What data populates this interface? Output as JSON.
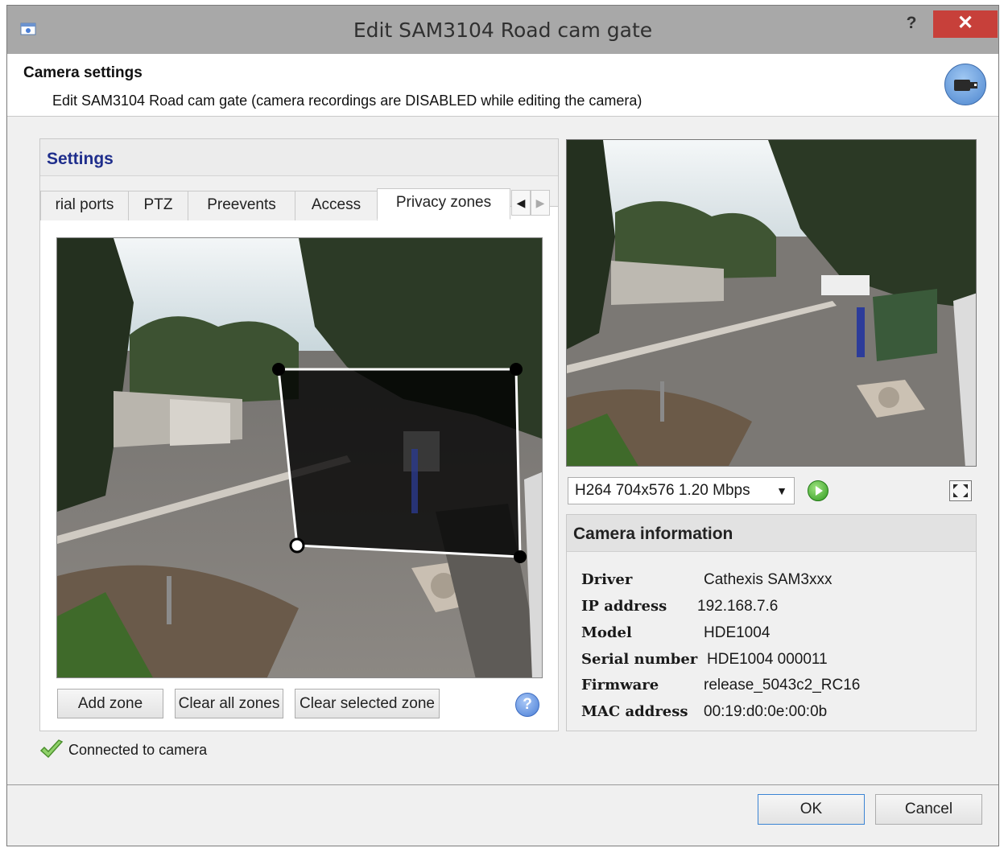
{
  "window": {
    "title": "Edit SAM3104 Road cam gate",
    "help_label": "?",
    "close_label": "✕"
  },
  "header": {
    "title": "Camera settings",
    "subtitle": "Edit SAM3104 Road cam gate (camera recordings are DISABLED while editing the camera)"
  },
  "settings": {
    "title": "Settings",
    "tabs": [
      "rial ports",
      "PTZ",
      "Preevents",
      "Access",
      "Privacy zones"
    ],
    "active_tab": "Privacy zones",
    "buttons": {
      "add_zone": "Add zone",
      "clear_all": "Clear all zones",
      "clear_selected": "Clear selected zone",
      "help": "?"
    }
  },
  "status": {
    "text": "Connected to camera"
  },
  "preview": {
    "stream": "H264 704x576 1.20 Mbps"
  },
  "camera_info": {
    "title": "Camera information",
    "rows": [
      {
        "label": "Driver",
        "value": "Cathexis SAM3xxx"
      },
      {
        "label": "IP address",
        "value": "192.168.7.6"
      },
      {
        "label": "Model",
        "value": "HDE1004"
      },
      {
        "label": "Serial number",
        "value": "HDE1004 000011"
      },
      {
        "label": "Firmware",
        "value": "release_5043c2_RC16"
      },
      {
        "label": "MAC address",
        "value": "00:19:d0:0e:00:0b"
      }
    ]
  },
  "footer": {
    "ok": "OK",
    "cancel": "Cancel"
  }
}
